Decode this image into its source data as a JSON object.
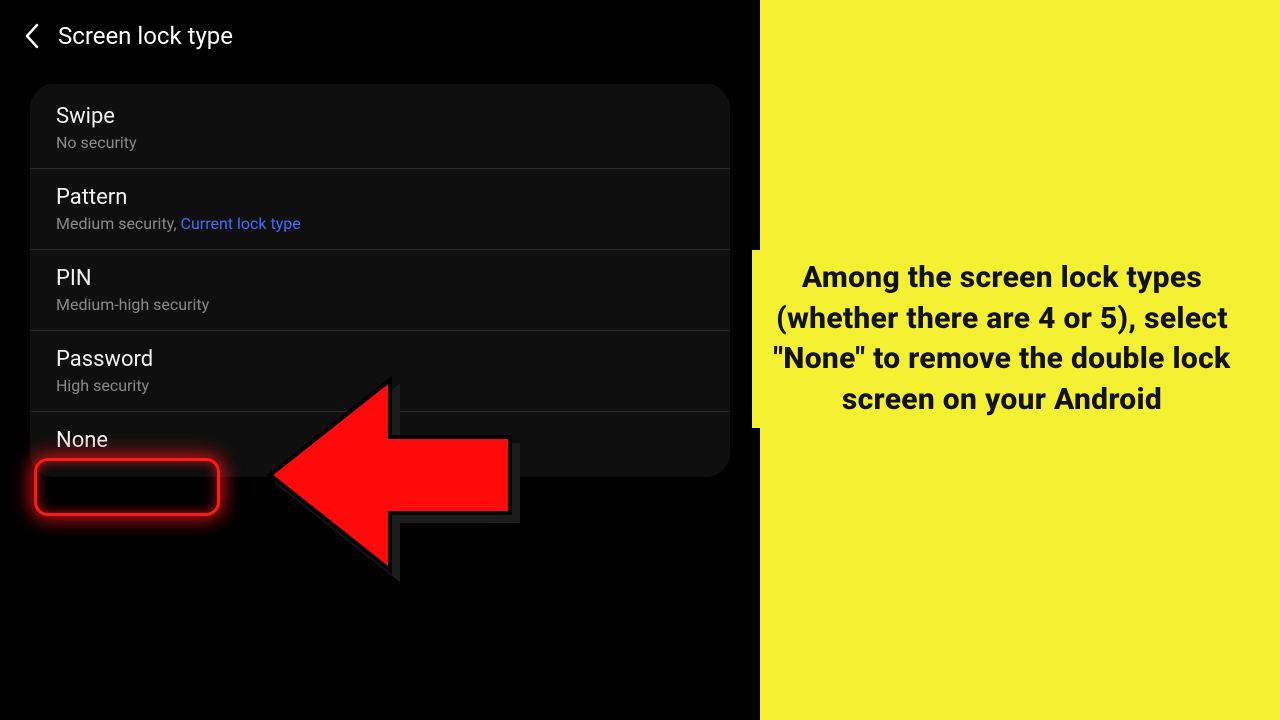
{
  "colors": {
    "accent_yellow": "#f4f032",
    "highlight_red": "#ff1a1a",
    "link_blue": "#3b6fff"
  },
  "header": {
    "title": "Screen lock type"
  },
  "options": {
    "swipe": {
      "title": "Swipe",
      "subtitle": "No security"
    },
    "pattern": {
      "title": "Pattern",
      "subtitle_prefix": "Medium security, ",
      "current_label": "Current lock type"
    },
    "pin": {
      "title": "PIN",
      "subtitle": "Medium-high security"
    },
    "password": {
      "title": "Password",
      "subtitle": "High security"
    },
    "none": {
      "title": "None"
    }
  },
  "instruction": {
    "text": "Among the screen lock types (whether there are 4 or 5), select \"None\" to remove the double lock screen on your Android"
  }
}
